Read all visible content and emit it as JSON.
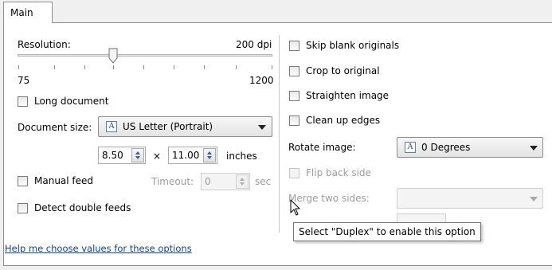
{
  "tabs": [
    {
      "label": "Main"
    }
  ],
  "left": {
    "resolution": {
      "label": "Resolution:",
      "value_text": "200 dpi",
      "min": "75",
      "max": "1200",
      "value": 200
    },
    "long_document": {
      "label": "Long document",
      "checked": false
    },
    "document_size": {
      "label": "Document size:",
      "selected": "US Letter (Portrait)"
    },
    "dimensions": {
      "width": "8.50",
      "times": "×",
      "height": "11.00",
      "unit": "inches"
    },
    "manual_feed": {
      "label": "Manual feed",
      "checked": false
    },
    "timeout": {
      "label": "Timeout:",
      "value": "0",
      "unit": "sec"
    },
    "detect_double_feeds": {
      "label": "Detect double feeds",
      "checked": false
    },
    "help_link": "Help me choose values for these options"
  },
  "right": {
    "skip_blank": {
      "label": "Skip blank originals",
      "checked": false
    },
    "crop": {
      "label": "Crop to original",
      "checked": false
    },
    "straighten": {
      "label": "Straighten image",
      "checked": false
    },
    "clean_edges": {
      "label": "Clean up edges",
      "checked": false
    },
    "rotate": {
      "label": "Rotate image:",
      "selected": "0 Degrees"
    },
    "flip_back": {
      "label": "Flip back side",
      "checked": false,
      "enabled": false
    },
    "merge": {
      "label": "Merge two sides:",
      "selected": "",
      "enabled": false
    }
  },
  "tooltip": "Select \"Duplex\" to enable this option",
  "icons": {
    "font_icon": "font-a-icon",
    "cursor": "arrow-cursor-icon"
  }
}
